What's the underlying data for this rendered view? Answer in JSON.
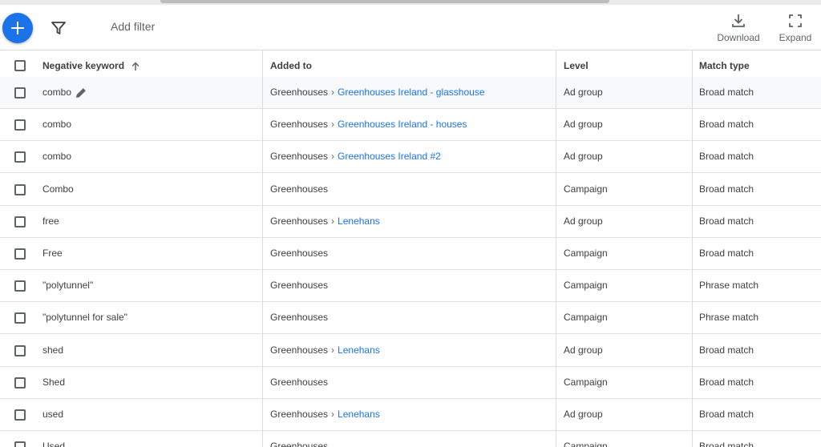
{
  "toolbar": {
    "add_filter": "Add filter",
    "download": "Download",
    "expand": "Expand"
  },
  "columns": {
    "keyword": "Negative keyword",
    "added_to": "Added to",
    "level": "Level",
    "match_type": "Match type"
  },
  "rows": [
    {
      "keyword": "combo",
      "campaign": "Greenhouses",
      "adgroup": "Greenhouses Ireland - glasshouse",
      "level": "Ad group",
      "match": "Broad match"
    },
    {
      "keyword": "combo",
      "campaign": "Greenhouses",
      "adgroup": "Greenhouses Ireland - houses",
      "level": "Ad group",
      "match": "Broad match"
    },
    {
      "keyword": "combo",
      "campaign": "Greenhouses",
      "adgroup": "Greenhouses Ireland #2",
      "level": "Ad group",
      "match": "Broad match"
    },
    {
      "keyword": "Combo",
      "campaign": "Greenhouses",
      "adgroup": "",
      "level": "Campaign",
      "match": "Broad match"
    },
    {
      "keyword": "free",
      "campaign": "Greenhouses",
      "adgroup": "Lenehans",
      "level": "Ad group",
      "match": "Broad match"
    },
    {
      "keyword": "Free",
      "campaign": "Greenhouses",
      "adgroup": "",
      "level": "Campaign",
      "match": "Broad match"
    },
    {
      "keyword": "\"polytunnel\"",
      "campaign": "Greenhouses",
      "adgroup": "",
      "level": "Campaign",
      "match": "Phrase match"
    },
    {
      "keyword": "\"polytunnel for sale\"",
      "campaign": "Greenhouses",
      "adgroup": "",
      "level": "Campaign",
      "match": "Phrase match"
    },
    {
      "keyword": "shed",
      "campaign": "Greenhouses",
      "adgroup": "Lenehans",
      "level": "Ad group",
      "match": "Broad match"
    },
    {
      "keyword": "Shed",
      "campaign": "Greenhouses",
      "adgroup": "",
      "level": "Campaign",
      "match": "Broad match"
    },
    {
      "keyword": "used",
      "campaign": "Greenhouses",
      "adgroup": "Lenehans",
      "level": "Ad group",
      "match": "Broad match"
    },
    {
      "keyword": "Used",
      "campaign": "Greenhouses",
      "adgroup": "",
      "level": "Campaign",
      "match": "Broad match"
    }
  ],
  "icons": {
    "add": "plus-icon",
    "filter": "filter-icon",
    "download": "download-icon",
    "expand": "expand-icon",
    "sort": "arrow-up-icon",
    "edit": "pencil-icon"
  },
  "colors": {
    "accent": "#1a73e8",
    "text": "#3c4043",
    "muted": "#5f6368",
    "border": "#dadce0"
  }
}
